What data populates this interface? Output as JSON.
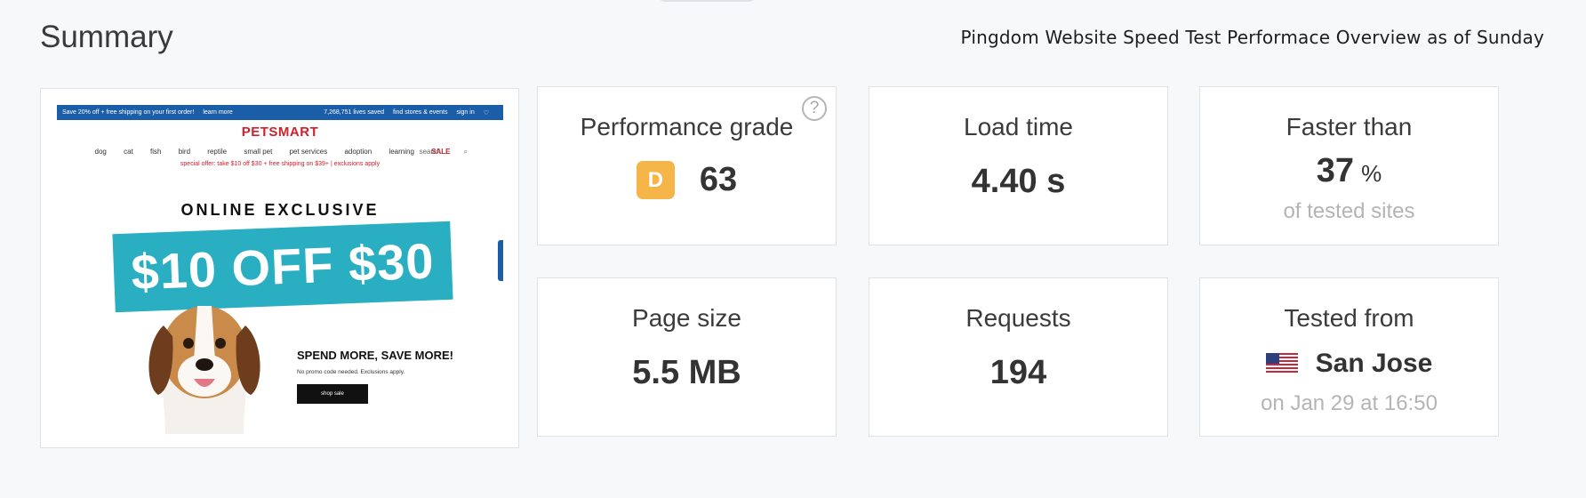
{
  "header": {
    "title": "Summary",
    "subtitle": "Pingdom Website Speed Test Performace Overview as of Sunday"
  },
  "screenshot": {
    "promo_left": "Save 20% off + free shipping on your first order!",
    "promo_link": "learn more",
    "promo_lives": "7,268,751 lives saved",
    "promo_stores": "find stores & events",
    "promo_signin": "sign in",
    "logo": "PETSMART",
    "nav": [
      "dog",
      "cat",
      "fish",
      "bird",
      "reptile",
      "small pet",
      "pet services",
      "adoption",
      "learning"
    ],
    "nav_sale": "SALE",
    "search_placeholder": "search...",
    "special_offer": "special offer: take $10 off $30 + free shipping on $39+ | exclusions apply",
    "headline": "ONLINE EXCLUSIVE",
    "banner": "$10 OFF $30",
    "spend": "SPEND MORE, SAVE MORE!",
    "no_promo": "No promo code needed. Exclusions apply.",
    "shop_button": "shop sale"
  },
  "metrics": {
    "performance_grade": {
      "label": "Performance grade",
      "grade": "D",
      "score": "63",
      "help": "?"
    },
    "load_time": {
      "label": "Load time",
      "value": "4.40 s"
    },
    "faster_than": {
      "label": "Faster than",
      "value": "37",
      "unit": "%",
      "sub": "of tested sites"
    },
    "page_size": {
      "label": "Page size",
      "value": "5.5 MB"
    },
    "requests": {
      "label": "Requests",
      "value": "194"
    },
    "tested_from": {
      "label": "Tested from",
      "location": "San Jose",
      "date": "on Jan 29 at 16:50"
    }
  },
  "colors": {
    "grade_badge": "#f5b548",
    "banner": "#2aaec1",
    "promo_bar": "#1b5ea8",
    "brand_red": "#d0202d"
  }
}
